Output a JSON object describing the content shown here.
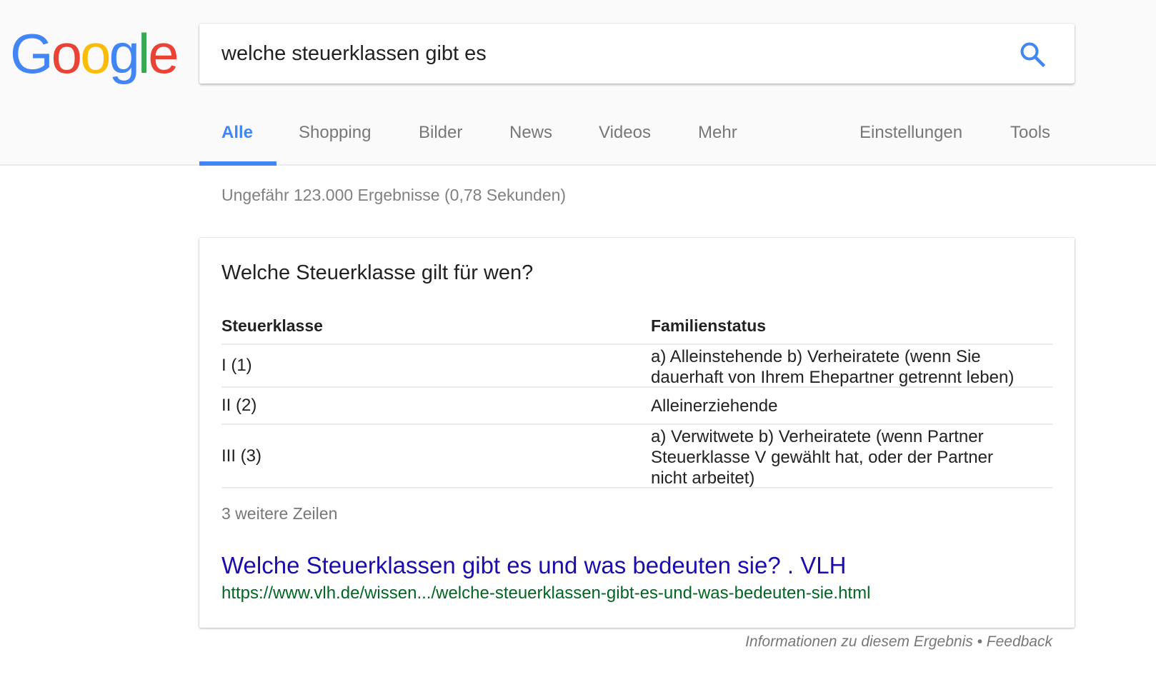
{
  "logo": {
    "letters": [
      "G",
      "o",
      "o",
      "g",
      "l",
      "e"
    ],
    "colors": [
      "#4285f4",
      "#ea4335",
      "#fbbc05",
      "#4285f4",
      "#34a853",
      "#ea4335"
    ]
  },
  "search": {
    "query": "welche steuerklassen gibt es",
    "icon": "search-icon",
    "accent": "#4285f4"
  },
  "tabs": [
    {
      "label": "Alle",
      "active": true
    },
    {
      "label": "Shopping"
    },
    {
      "label": "Bilder"
    },
    {
      "label": "News"
    },
    {
      "label": "Videos"
    },
    {
      "label": "Mehr"
    },
    {
      "label": "Einstellungen"
    },
    {
      "label": "Tools"
    }
  ],
  "stats": "Ungefähr 123.000 Ergebnisse (0,78 Sekunden)",
  "snippet": {
    "title": "Welche Steuerklasse gilt für wen?",
    "table": {
      "headers": [
        "Steuerklasse",
        "Familienstatus"
      ],
      "rows": [
        [
          "I (1)",
          "a) Alleinstehende b) Verheiratete (wenn Sie dauerhaft von Ihrem Ehepartner getrennt leben)"
        ],
        [
          "II (2)",
          "Alleinerziehende"
        ],
        [
          "III (3)",
          "a) Verwitwete b) Verheiratete (wenn Partner Steuerklasse V gewählt hat, oder der Partner nicht arbeitet)"
        ]
      ]
    },
    "more_rows": "3 weitere Zeilen",
    "result_title": "Welche Steuerklassen gibt es und was bedeuten sie? . VLH",
    "result_url": "https://www.vlh.de/wissen.../welche-steuerklassen-gibt-es-und-was-bedeuten-sie.html"
  },
  "footer": {
    "info": "Informationen zu diesem Ergebnis",
    "separator": " • ",
    "feedback": "Feedback"
  }
}
